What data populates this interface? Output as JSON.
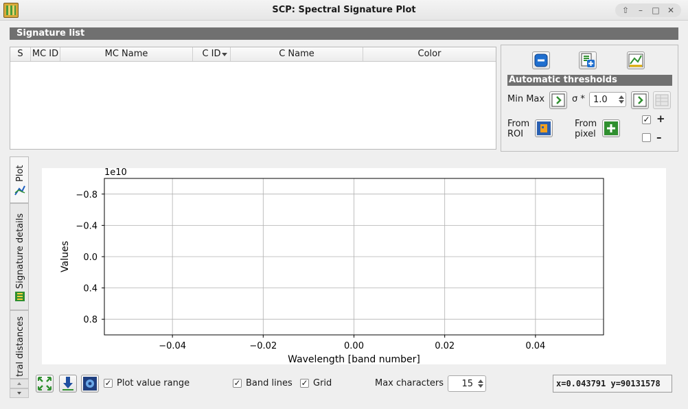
{
  "window": {
    "title": "SCP: Spectral Signature Plot",
    "controls": [
      "⇧",
      "–",
      "□",
      "✕"
    ]
  },
  "signature_list": {
    "header": "Signature list",
    "columns": [
      "S",
      "MC ID",
      "MC Name",
      "C ID",
      "C Name",
      "Color"
    ]
  },
  "right_panel": {
    "auto_thresholds_label": "Automatic  thresholds",
    "min_max_label": "Min Max",
    "sigma_label": "σ *",
    "sigma_value": "1.0",
    "from_roi_label_1": "From",
    "from_roi_label_2": "ROI",
    "from_pixel_label_1": "From",
    "from_pixel_label_2": "pixel",
    "plus_checked": true,
    "plus_symbol": "+",
    "minus_checked": false,
    "minus_symbol": "–"
  },
  "side_tabs": [
    "Plot",
    "Signature details",
    "tral distances"
  ],
  "chart_data": {
    "type": "line",
    "series": [],
    "offset_label": "1e10",
    "xlabel": "Wavelength [band number]",
    "ylabel": "Values",
    "xlim": [
      -0.055,
      0.055
    ],
    "ylim": [
      1.0,
      -1.0
    ],
    "xticks": [
      -0.04,
      -0.02,
      0.0,
      0.02,
      0.04
    ],
    "xtick_labels": [
      "−0.04",
      "−0.02",
      "0.00",
      "0.02",
      "0.04"
    ],
    "yticks": [
      -0.8,
      -0.4,
      0.0,
      0.4,
      0.8
    ],
    "ytick_labels": [
      "−0.8",
      "−0.4",
      "0.0",
      "0.4",
      "0.8"
    ],
    "grid": true
  },
  "bottom_bar": {
    "plot_value_range_label": "Plot value range",
    "plot_value_range_checked": true,
    "band_lines_label": "Band lines",
    "band_lines_checked": true,
    "grid_label": "Grid",
    "grid_checked": true,
    "max_characters_label": "Max characters",
    "max_characters_value": "15",
    "coordinates": "x=0.043791 y=90131578"
  },
  "colors": {
    "section_header": "#707070",
    "tool_green": "#2f8f2f",
    "tool_blue": "#1f5fbf"
  }
}
